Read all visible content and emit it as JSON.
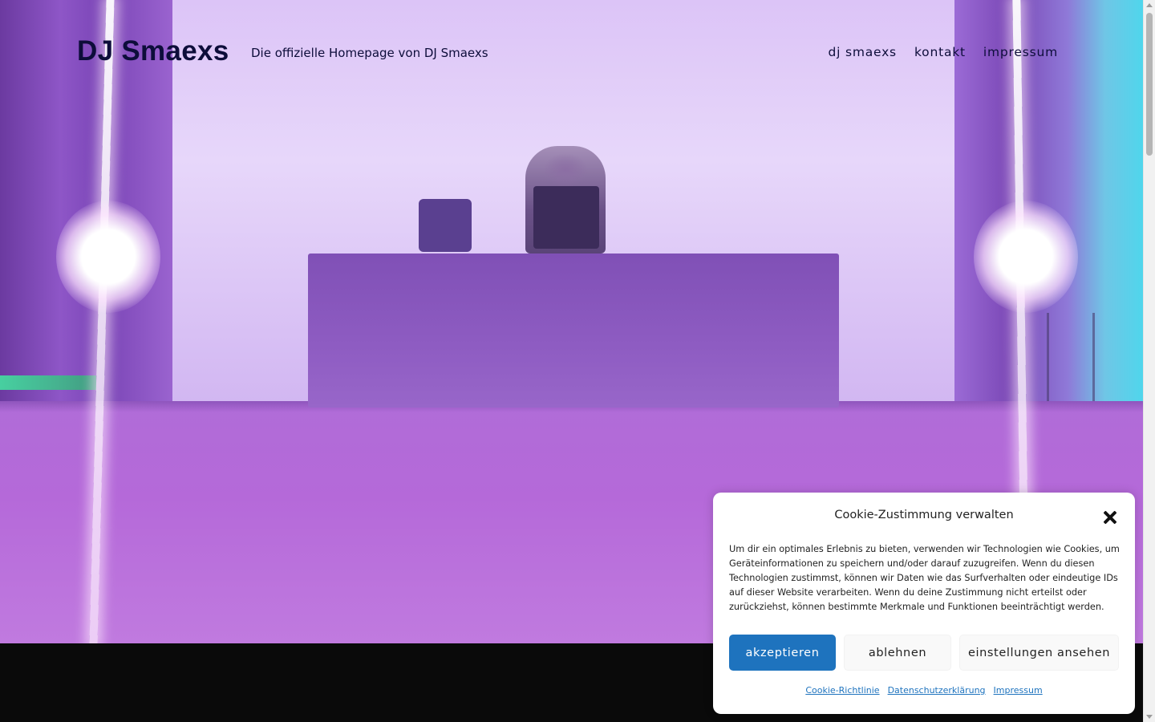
{
  "header": {
    "site_title": "DJ Smaexs",
    "tagline": "Die offizielle Homepage von DJ Smaexs",
    "nav": [
      {
        "label": "dj smaexs"
      },
      {
        "label": "kontakt"
      },
      {
        "label": "impressum"
      }
    ]
  },
  "hero": {
    "image": "dj-on-stage-purple-light-photo"
  },
  "cookie_banner": {
    "title": "Cookie-Zustimmung verwalten",
    "text": "Um dir ein optimales Erlebnis zu bieten, verwenden wir Technologien wie Cookies, um Geräteinformationen zu speichern und/oder darauf zuzugreifen. Wenn du diesen Technologien zustimmst, können wir Daten wie das Surfverhalten oder eindeutige IDs auf dieser Website verarbeiten. Wenn du deine Zustimmung nicht erteilst oder zurückziehst, können bestimmte Merkmale und Funktionen beeinträchtigt werden.",
    "buttons": {
      "accept": "akzeptieren",
      "deny": "ablehnen",
      "settings": "einstellungen ansehen"
    },
    "links": [
      {
        "label": "Cookie-Richtlinie"
      },
      {
        "label": "Datenschutzerklärung"
      },
      {
        "label": "Impressum"
      }
    ],
    "close_icon": "close-icon",
    "accent_color": "#1e73be"
  },
  "colors": {
    "title_text": "#0d0d3a",
    "footer_band": "#0a0a0a"
  }
}
